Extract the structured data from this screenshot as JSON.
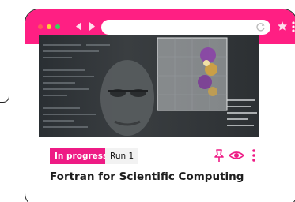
{
  "card": {
    "status_badge": "In progress",
    "run_badge": "Run 1",
    "title": "Fortran for Scientific Computing"
  },
  "browser": {
    "url": ""
  },
  "icons": {
    "pin": "pin-icon",
    "eye": "eye-icon",
    "more": "more-vertical-icon",
    "back": "chevron-left-icon",
    "forward": "chevron-right-icon",
    "reload": "reload-icon",
    "star": "star-icon"
  },
  "colors": {
    "brand": "#ff1f83",
    "badge_progress": "#ee1b85",
    "badge_run_bg": "#f2f2f2"
  }
}
